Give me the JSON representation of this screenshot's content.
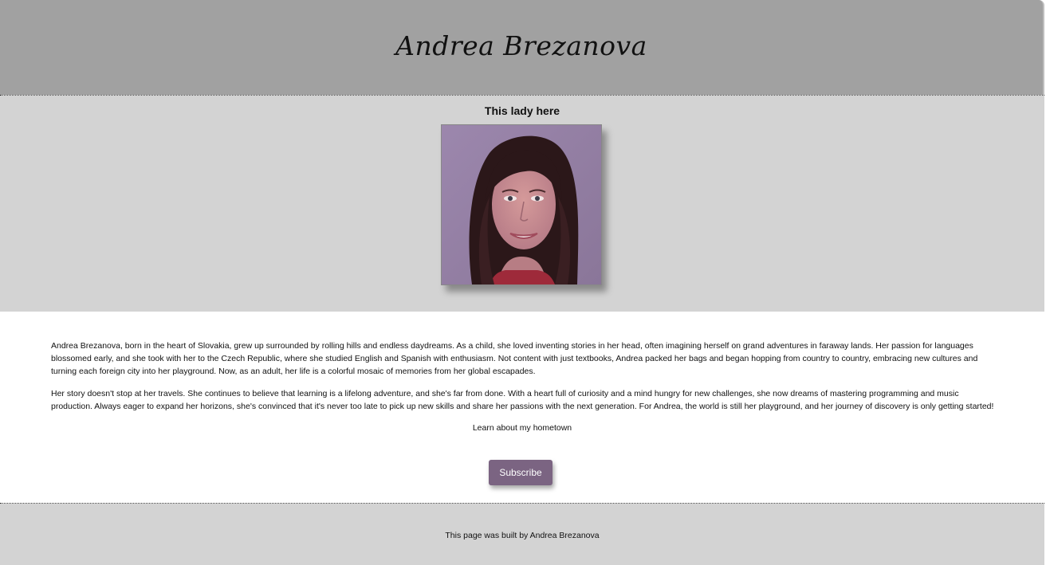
{
  "header": {
    "title": "Andrea Brezanova"
  },
  "hero": {
    "caption": "This lady here",
    "photo_alt": "portrait photo"
  },
  "content": {
    "paragraphs": [
      "Andrea Brezanova, born in the heart of Slovakia, grew up surrounded by rolling hills and endless daydreams. As a child, she loved inventing stories in her head, often imagining herself on grand adventures in faraway lands. Her passion for languages blossomed early, and she took with her to the Czech Republic, where she studied English and Spanish with enthusiasm. Not content with just textbooks, Andrea packed her bags and began hopping from country to country, embracing new cultures and turning each foreign city into her playground. Now, as an adult, her life is a colorful mosaic of memories from her global escapades.",
      "Her story doesn't stop at her travels. She continues to believe that learning is a lifelong adventure, and she's far from done. With a heart full of curiosity and a mind hungry for new challenges, she now dreams of mastering programming and music production. Always eager to expand her horizons, she's convinced that it's never too late to pick up new skills and share her passions with the next generation. For Andrea, the world is still her playground, and her journey of discovery is only getting started!"
    ],
    "hometown_link": "Learn about my hometown",
    "subscribe_label": "Subscribe"
  },
  "footer": {
    "text": "This page was built by Andrea Brezanova"
  },
  "colors": {
    "header_bg": "#a1a1a1",
    "hero_bg": "#d3d3d3",
    "button_bg": "#7b6482"
  }
}
